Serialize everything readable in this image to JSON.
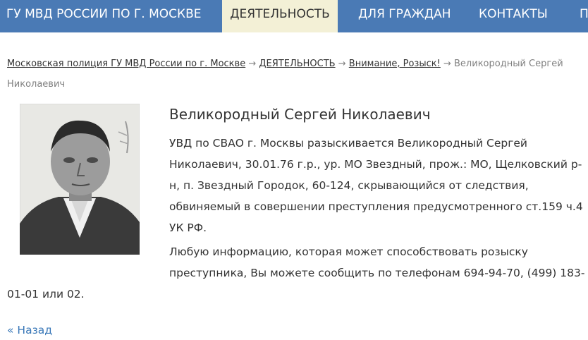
{
  "nav": {
    "items": [
      {
        "label": "ГУ МВД РОССИИ ПО Г. МОСКВЕ"
      },
      {
        "label": "ДЕЯТЕЛЬНОСТЬ"
      },
      {
        "label": "ДЛЯ ГРАЖДАН"
      },
      {
        "label": "КОНТАКТЫ"
      },
      {
        "label": "П"
      }
    ],
    "active_index": 1
  },
  "breadcrumb": {
    "links": [
      "Московская полиция ГУ МВД России по г. Москве",
      "ДЕЯТЕЛЬНОСТЬ",
      "Внимание, Розыск!"
    ],
    "separator": "→",
    "current": "Великородный Сергей Николаевич"
  },
  "article": {
    "title": "Великородный Сергей Николаевич",
    "paragraph1": "УВД по СВАО г. Москвы разыскивается Великородный Сергей Николаевич, 30.01.76 г.р., ур. МО Звездный, прож.: МО, Щелковский р-н, п. Звездный Городок, 60-124, скрывающийся от следствия, обвиняемый в совершении преступления предусмотренного ст.159 ч.4 УК РФ.",
    "paragraph2": "Любую информацию, которая может способствовать розыску преступника, Вы можете сообщить по телефонам 694-94-70, (499) 183-01-01 или 02."
  },
  "back_link": "« Назад",
  "colors": {
    "nav_bg": "#4a7ab5",
    "nav_active_bg": "#f3f0d6",
    "link": "#3a78b8"
  },
  "photo": {
    "icon": "portrait-photo"
  }
}
